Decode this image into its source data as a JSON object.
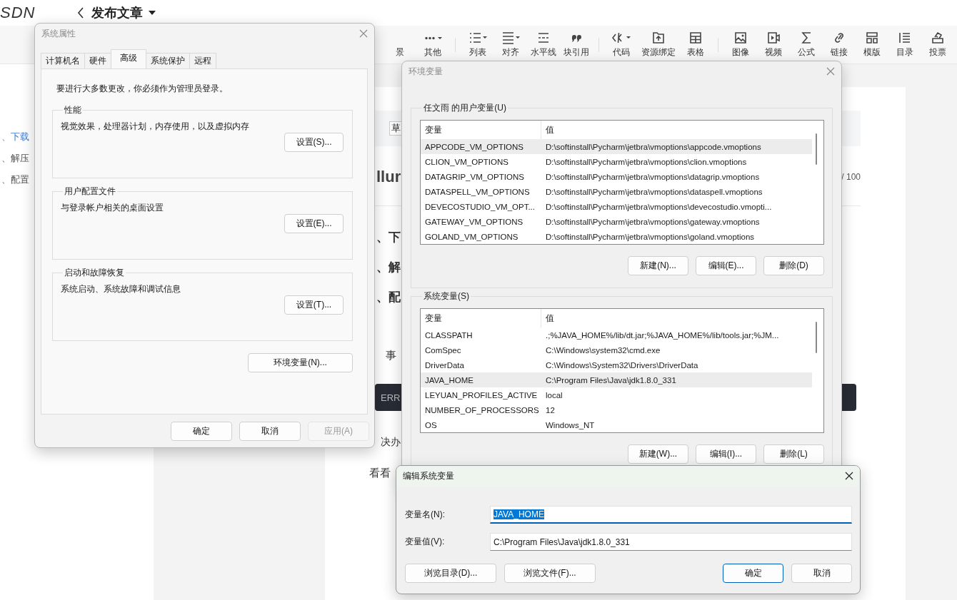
{
  "editor": {
    "logo": "SDN",
    "title": "发布文章",
    "toolbar_groups": [
      [
        "景",
        "其他"
      ],
      [
        "列表",
        "对齐",
        "水平线",
        "块引用"
      ],
      [
        "代码",
        "资源绑定",
        "表格"
      ],
      [
        "图像",
        "视频",
        "公式",
        "链接",
        "模版",
        "目录",
        "投票"
      ]
    ],
    "outline": [
      {
        "label": "、下载",
        "selected": true
      },
      {
        "label": "、解压",
        "selected": false
      },
      {
        "label": "、配置",
        "selected": false
      }
    ],
    "article": {
      "draft_tag": "草",
      "title_fragment": "llur",
      "title_counter": "/ 100",
      "headings": [
        "、下",
        "、解",
        "、配"
      ],
      "paragraph": "事",
      "code_fragment": "ERR",
      "paragraphs": [
        "决办",
        "看看"
      ]
    }
  },
  "system_properties": {
    "title": "系统属性",
    "tabs": [
      {
        "label": "计算机名",
        "selected": false
      },
      {
        "label": "硬件",
        "selected": false
      },
      {
        "label": "高级",
        "selected": true
      },
      {
        "label": "系统保护",
        "selected": false
      },
      {
        "label": "远程",
        "selected": false
      }
    ],
    "admin_note": "要进行大多数更改，你必须作为管理员登录。",
    "groups": [
      {
        "title": "性能",
        "description": "视觉效果，处理器计划，内存使用，以及虚拟内存",
        "button": "设置(S)..."
      },
      {
        "title": "用户配置文件",
        "description": "与登录帐户相关的桌面设置",
        "button": "设置(E)..."
      },
      {
        "title": "启动和故障恢复",
        "description": "系统启动、系统故障和调试信息",
        "button": "设置(T)..."
      }
    ],
    "env_button": "环境变量(N)...",
    "buttons": [
      {
        "label": "确定",
        "disabled": false
      },
      {
        "label": "取消",
        "disabled": false
      },
      {
        "label": "应用(A)",
        "disabled": true
      }
    ]
  },
  "environment_variables": {
    "title": "环境变量",
    "user_variables": {
      "title": "任文雨 的用户变量(U)",
      "columns": [
        "变量",
        "值"
      ],
      "rows": [
        {
          "name": "APPCODE_VM_OPTIONS",
          "value": "D:\\softinstall\\Pycharm\\jetbra\\vmoptions\\appcode.vmoptions",
          "selected": true
        },
        {
          "name": "CLION_VM_OPTIONS",
          "value": "D:\\softinstall\\Pycharm\\jetbra\\vmoptions\\clion.vmoptions",
          "selected": false
        },
        {
          "name": "DATAGRIP_VM_OPTIONS",
          "value": "D:\\softinstall\\Pycharm\\jetbra\\vmoptions\\datagrip.vmoptions",
          "selected": false
        },
        {
          "name": "DATASPELL_VM_OPTIONS",
          "value": "D:\\softinstall\\Pycharm\\jetbra\\vmoptions\\dataspell.vmoptions",
          "selected": false
        },
        {
          "name": "DEVECOSTUDIO_VM_OPT...",
          "value": "D:\\softinstall\\Pycharm\\jetbra\\vmoptions\\devecostudio.vmopti...",
          "selected": false
        },
        {
          "name": "GATEWAY_VM_OPTIONS",
          "value": "D:\\softinstall\\Pycharm\\jetbra\\vmoptions\\gateway.vmoptions",
          "selected": false
        },
        {
          "name": "GOLAND_VM_OPTIONS",
          "value": "D:\\softinstall\\Pycharm\\jetbra\\vmoptions\\goland.vmoptions",
          "selected": false
        }
      ],
      "buttons": [
        "新建(N)...",
        "编辑(E)...",
        "删除(D)"
      ]
    },
    "system_variables": {
      "title": "系统变量(S)",
      "columns": [
        "变量",
        "值"
      ],
      "rows": [
        {
          "name": "CLASSPATH",
          "value": ".;%JAVA_HOME%/lib/dt.jar;%JAVA_HOME%/lib/tools.jar;%JM...",
          "selected": false
        },
        {
          "name": "ComSpec",
          "value": "C:\\Windows\\system32\\cmd.exe",
          "selected": false
        },
        {
          "name": "DriverData",
          "value": "C:\\Windows\\System32\\Drivers\\DriverData",
          "selected": false
        },
        {
          "name": "JAVA_HOME",
          "value": "C:\\Program Files\\Java\\jdk1.8.0_331",
          "selected": true
        },
        {
          "name": "LEYUAN_PROFILES_ACTIVE",
          "value": "local",
          "selected": false
        },
        {
          "name": "NUMBER_OF_PROCESSORS",
          "value": "12",
          "selected": false
        },
        {
          "name": "OS",
          "value": "Windows_NT",
          "selected": false
        }
      ],
      "buttons": [
        "新建(W)...",
        "编辑(I)...",
        "删除(L)"
      ]
    }
  },
  "edit_variable": {
    "title": "编辑系统变量",
    "fields": [
      {
        "label": "变量名(N):",
        "value": "JAVA_HOME",
        "focused": true
      },
      {
        "label": "变量值(V):",
        "value": "C:\\Program Files\\Java\\jdk1.8.0_331",
        "focused": false
      }
    ],
    "buttons": [
      {
        "label": "浏览目录(D)...",
        "default": false
      },
      {
        "label": "浏览文件(F)...",
        "default": false
      },
      {
        "label": "确定",
        "default": true
      },
      {
        "label": "取消",
        "default": false
      }
    ]
  }
}
